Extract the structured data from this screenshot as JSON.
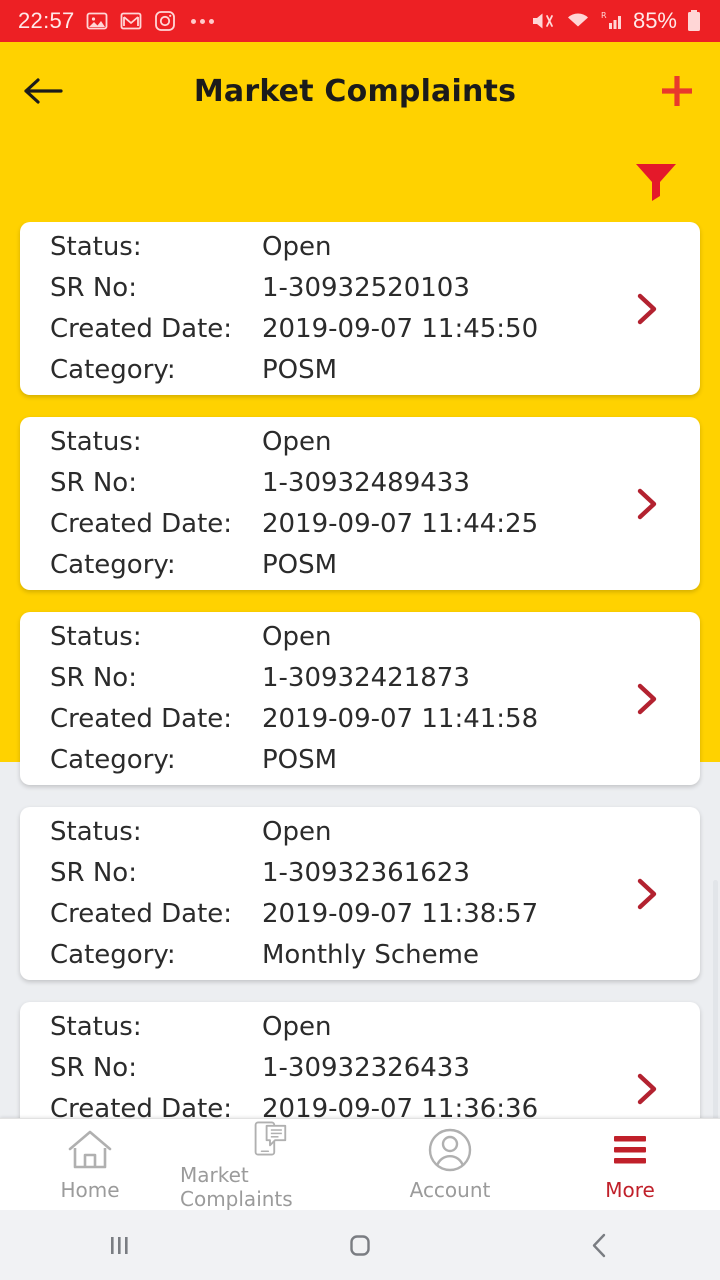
{
  "status_bar": {
    "time": "22:57",
    "battery_percent": "85%",
    "left_icons": [
      "photos-icon",
      "gmail-icon",
      "instagram-icon",
      "overflow-dots-icon"
    ],
    "right_icons": [
      "vibrate-mute-icon",
      "wifi-icon",
      "roaming-signal-icon",
      "battery-icon"
    ],
    "background_color": "#ed2024"
  },
  "header": {
    "title": "Market Complaints",
    "back_icon": "arrow-left-icon",
    "add_icon": "plus-icon",
    "filter_icon": "filter-funnel-icon",
    "background_color": "#ffd200",
    "accent_color": "#e8392c"
  },
  "list": {
    "field_labels": {
      "status": "Status:",
      "sr_no": "SR No:",
      "created_date": "Created Date:",
      "category": "Category:"
    },
    "chevron_icon": "chevron-right-icon",
    "chevron_color": "#b32230",
    "items": [
      {
        "status": "Open",
        "sr_no": "1-30932520103",
        "created_date": "2019-09-07 11:45:50",
        "category": "POSM"
      },
      {
        "status": "Open",
        "sr_no": "1-30932489433",
        "created_date": "2019-09-07 11:44:25",
        "category": "POSM"
      },
      {
        "status": "Open",
        "sr_no": "1-30932421873",
        "created_date": "2019-09-07 11:41:58",
        "category": "POSM"
      },
      {
        "status": "Open",
        "sr_no": "1-30932361623",
        "created_date": "2019-09-07 11:38:57",
        "category": "Monthly Scheme"
      },
      {
        "status": "Open",
        "sr_no": "1-30932326433",
        "created_date": "2019-09-07 11:36:36",
        "category": ""
      }
    ]
  },
  "bottom_nav": {
    "items": [
      {
        "label": "Home",
        "icon": "home-icon",
        "active": false
      },
      {
        "label": "Market Complaints",
        "icon": "phone-chat-icon",
        "active": false
      },
      {
        "label": "Account",
        "icon": "person-circle-icon",
        "active": false
      },
      {
        "label": "More",
        "icon": "hamburger-menu-icon",
        "active": true
      }
    ],
    "active_color": "#c0202a",
    "inactive_color": "#9b9b9b"
  },
  "android_nav": {
    "recents_icon": "recents-icon",
    "home_icon": "home-square-icon",
    "back_icon": "back-chevron-icon"
  }
}
